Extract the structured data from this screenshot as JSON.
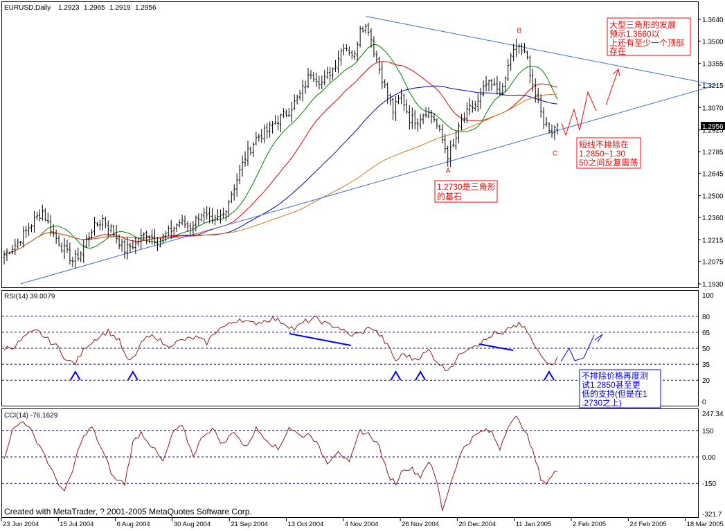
{
  "header": {
    "symbol": "EURUSD,Daily",
    "ohlc": [
      "1.2923",
      "1.2965",
      "1.2919",
      "1.2956"
    ]
  },
  "colors": {
    "price_bars": "#000000",
    "ma_short": "#008000",
    "ma_mid": "#e00000",
    "ma_long": "#0000c0",
    "ma_longest": "#d27a1e",
    "trendline": "#3a6fd0",
    "red_annotation": "#ff0000",
    "blue_annotation": "#0000ff",
    "rsi_line": "#8b1a1a",
    "cci_line": "#8b1a1a",
    "level_line": "#0000a0",
    "current_price_tag": "#000000"
  },
  "chart_data": [
    {
      "type": "ohlc",
      "name": "price",
      "title": "EURUSD,Daily",
      "ylim": [
        1.193,
        1.364
      ],
      "y_ticks": [
        "1.3640",
        "1.3500",
        "1.3355",
        "1.3215",
        "1.3070",
        "1.2925",
        "1.2785",
        "1.2645",
        "1.2500",
        "1.2360",
        "1.2215",
        "1.2075",
        "1.1930"
      ],
      "current_price": "1.2956",
      "x_labels": [
        "23 Jun 2004",
        "15 Jul 2004",
        "6 Aug 2004",
        "30 Aug 2004",
        "21 Sep 2004",
        "13 Oct 2004",
        "4 Nov 2004",
        "26 Nov 2004",
        "20 Dec 2004",
        "11 Jan 2005",
        "2 Feb 2005",
        "24 Feb 2005",
        "18 Mar 2005"
      ],
      "close_anchors": [
        [
          0,
          1.212
        ],
        [
          5,
          1.22
        ],
        [
          10,
          1.232
        ],
        [
          14,
          1.24
        ],
        [
          18,
          1.225
        ],
        [
          22,
          1.215
        ],
        [
          25,
          1.208
        ],
        [
          28,
          1.213
        ],
        [
          32,
          1.228
        ],
        [
          36,
          1.235
        ],
        [
          40,
          1.226
        ],
        [
          44,
          1.215
        ],
        [
          48,
          1.219
        ],
        [
          52,
          1.226
        ],
        [
          56,
          1.221
        ],
        [
          60,
          1.226
        ],
        [
          64,
          1.233
        ],
        [
          68,
          1.23
        ],
        [
          72,
          1.239
        ],
        [
          76,
          1.232
        ],
        [
          80,
          1.238
        ],
        [
          84,
          1.256
        ],
        [
          88,
          1.275
        ],
        [
          92,
          1.287
        ],
        [
          96,
          1.292
        ],
        [
          100,
          1.299
        ],
        [
          104,
          1.305
        ],
        [
          108,
          1.315
        ],
        [
          112,
          1.33
        ],
        [
          116,
          1.323
        ],
        [
          120,
          1.332
        ],
        [
          124,
          1.348
        ],
        [
          128,
          1.34
        ],
        [
          130,
          1.36
        ],
        [
          133,
          1.358
        ],
        [
          136,
          1.338
        ],
        [
          139,
          1.32
        ],
        [
          142,
          1.305
        ],
        [
          145,
          1.315
        ],
        [
          148,
          1.3
        ],
        [
          151,
          1.299
        ],
        [
          154,
          1.305
        ],
        [
          157,
          1.3
        ],
        [
          160,
          1.286
        ],
        [
          162,
          1.276
        ],
        [
          164,
          1.282
        ],
        [
          167,
          1.298
        ],
        [
          170,
          1.306
        ],
        [
          173,
          1.31
        ],
        [
          176,
          1.322
        ],
        [
          179,
          1.32
        ],
        [
          182,
          1.318
        ],
        [
          185,
          1.341
        ],
        [
          188,
          1.347
        ],
        [
          191,
          1.338
        ],
        [
          194,
          1.315
        ],
        [
          197,
          1.298
        ],
        [
          200,
          1.292
        ],
        [
          202,
          1.2956
        ]
      ],
      "moving_averages": [
        {
          "name": "ma_short",
          "color_key": "ma_short",
          "period": 14
        },
        {
          "name": "ma_mid",
          "color_key": "ma_mid",
          "period": 30
        },
        {
          "name": "ma_long",
          "color_key": "ma_long",
          "period": 60
        },
        {
          "name": "ma_longest",
          "color_key": "ma_longest",
          "period": 110
        }
      ],
      "trendlines": [
        {
          "name": "upper-trendline",
          "from": [
            132,
            1.366
          ],
          "to": [
            260,
            1.3215
          ]
        },
        {
          "name": "lower-trendline",
          "from": [
            6,
            1.193
          ],
          "to": [
            260,
            1.3215
          ]
        }
      ],
      "markers": [
        {
          "label": "A",
          "bar": 162,
          "price": 1.273
        },
        {
          "label": "B",
          "bar": 188,
          "price": 1.349
        },
        {
          "label": "C",
          "bar": 201,
          "price": 1.284
        }
      ],
      "annotations": [
        "大型三角形的发展预示1.3660以上还有至少一个顶部存在",
        "短线不排除在1.2850~1.3050之间反复震荡",
        "1.2730是三角形的基石"
      ]
    },
    {
      "type": "line",
      "name": "rsi",
      "title": "RSI(14) 39.0079",
      "ylim": [
        0,
        100
      ],
      "y_ticks": [
        "100",
        "80",
        "65",
        "50",
        "35",
        "20",
        "0"
      ],
      "levels": [
        80,
        65,
        50,
        35,
        20
      ],
      "anchors": [
        [
          0,
          50
        ],
        [
          4,
          52
        ],
        [
          8,
          62
        ],
        [
          12,
          66
        ],
        [
          16,
          58
        ],
        [
          20,
          50
        ],
        [
          23,
          38
        ],
        [
          26,
          36
        ],
        [
          30,
          52
        ],
        [
          34,
          60
        ],
        [
          38,
          66
        ],
        [
          42,
          57
        ],
        [
          45,
          38
        ],
        [
          47,
          40
        ],
        [
          51,
          58
        ],
        [
          55,
          62
        ],
        [
          59,
          52
        ],
        [
          62,
          55
        ],
        [
          66,
          58
        ],
        [
          70,
          60
        ],
        [
          74,
          55
        ],
        [
          78,
          68
        ],
        [
          82,
          72
        ],
        [
          86,
          78
        ],
        [
          90,
          73
        ],
        [
          94,
          75
        ],
        [
          98,
          78
        ],
        [
          102,
          74
        ],
        [
          106,
          68
        ],
        [
          110,
          75
        ],
        [
          114,
          78
        ],
        [
          118,
          72
        ],
        [
          122,
          70
        ],
        [
          126,
          62
        ],
        [
          130,
          64
        ],
        [
          134,
          70
        ],
        [
          138,
          60
        ],
        [
          141,
          48
        ],
        [
          143,
          38
        ],
        [
          146,
          45
        ],
        [
          149,
          40
        ],
        [
          152,
          42
        ],
        [
          155,
          48
        ],
        [
          158,
          38
        ],
        [
          161,
          30
        ],
        [
          164,
          35
        ],
        [
          167,
          46
        ],
        [
          170,
          52
        ],
        [
          173,
          54
        ],
        [
          176,
          58
        ],
        [
          179,
          64
        ],
        [
          182,
          62
        ],
        [
          185,
          70
        ],
        [
          188,
          72
        ],
        [
          191,
          66
        ],
        [
          194,
          50
        ],
        [
          197,
          40
        ],
        [
          200,
          36
        ],
        [
          202,
          40
        ]
      ],
      "arrows_up_bars": [
        26,
        47,
        143,
        152,
        199
      ],
      "annotation": "不排除价格再度测试1.2850甚至更低的支持(但是在1.2730之上)"
    },
    {
      "type": "line",
      "name": "cci",
      "title": "CCI(14) -76.1629",
      "ylim": [
        -321.7,
        247.34
      ],
      "y_ticks": [
        "247.34",
        "150",
        "0.00",
        "-150",
        "-321.7"
      ],
      "levels": [
        150,
        0,
        -150
      ],
      "anchors": [
        [
          0,
          0
        ],
        [
          3,
          150
        ],
        [
          7,
          210
        ],
        [
          10,
          140
        ],
        [
          14,
          40
        ],
        [
          18,
          -100
        ],
        [
          22,
          -200
        ],
        [
          25,
          -80
        ],
        [
          28,
          90
        ],
        [
          32,
          170
        ],
        [
          36,
          30
        ],
        [
          40,
          -120
        ],
        [
          44,
          -150
        ],
        [
          47,
          80
        ],
        [
          50,
          140
        ],
        [
          54,
          60
        ],
        [
          58,
          -30
        ],
        [
          62,
          150
        ],
        [
          65,
          170
        ],
        [
          69,
          10
        ],
        [
          73,
          130
        ],
        [
          76,
          160
        ],
        [
          80,
          70
        ],
        [
          84,
          150
        ],
        [
          88,
          50
        ],
        [
          92,
          160
        ],
        [
          96,
          100
        ],
        [
          100,
          40
        ],
        [
          104,
          170
        ],
        [
          108,
          120
        ],
        [
          112,
          130
        ],
        [
          115,
          50
        ],
        [
          118,
          -30
        ],
        [
          122,
          40
        ],
        [
          126,
          -40
        ],
        [
          130,
          150
        ],
        [
          134,
          120
        ],
        [
          137,
          60
        ],
        [
          140,
          -100
        ],
        [
          143,
          -150
        ],
        [
          146,
          -60
        ],
        [
          149,
          -70
        ],
        [
          152,
          -110
        ],
        [
          155,
          -20
        ],
        [
          158,
          -140
        ],
        [
          160,
          -300
        ],
        [
          162,
          -200
        ],
        [
          165,
          -50
        ],
        [
          168,
          60
        ],
        [
          172,
          120
        ],
        [
          175,
          150
        ],
        [
          178,
          140
        ],
        [
          181,
          50
        ],
        [
          184,
          180
        ],
        [
          187,
          220
        ],
        [
          190,
          160
        ],
        [
          193,
          30
        ],
        [
          196,
          -120
        ],
        [
          198,
          -150
        ],
        [
          200,
          -110
        ],
        [
          202,
          -76
        ]
      ]
    }
  ],
  "footer": {
    "credit": "Created with MetaTrader, ? 2001-2005 MetaQuotes Software Corp."
  }
}
